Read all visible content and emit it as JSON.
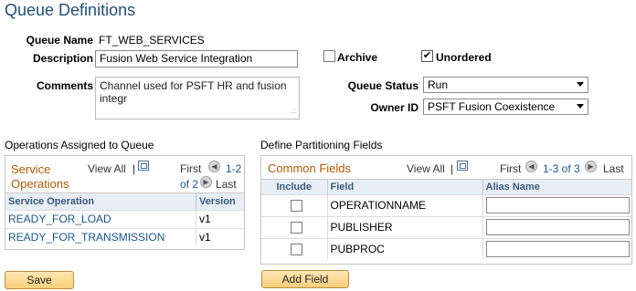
{
  "page": {
    "title": "Queue Definitions"
  },
  "form": {
    "queue_name_label": "Queue Name",
    "queue_name_value": "FT_WEB_SERVICES",
    "description_label": "Description",
    "description_value": "Fusion Web Service Integration",
    "archive_label": "Archive",
    "archive_checked": false,
    "unordered_label": "Unordered",
    "unordered_checked": true,
    "comments_label": "Comments",
    "comments_value": "Channel used for PSFT HR and fusion integr",
    "queue_status_label": "Queue Status",
    "queue_status_value": "Run",
    "owner_id_label": "Owner ID",
    "owner_id_value": "PSFT Fusion Coexistence"
  },
  "operations": {
    "section_title": "Operations Assigned to Queue",
    "caption_line1": "Service",
    "caption_line2": "Operations",
    "view_all": "View All",
    "first": "First",
    "range_line1": "1-2",
    "range_line2": "of 2",
    "last": "Last",
    "columns": [
      "Service Operation",
      "Version"
    ],
    "rows": [
      {
        "operation": "READY_FOR_LOAD",
        "version": "v1"
      },
      {
        "operation": "READY_FOR_TRANSMISSION",
        "version": "v1"
      }
    ]
  },
  "partitioning": {
    "section_title": "Define Partitioning Fields",
    "caption": "Common Fields",
    "view_all": "View All",
    "first": "First",
    "range": "1-3 of 3",
    "last": "Last",
    "columns": [
      "Include",
      "Field",
      "Alias Name"
    ],
    "rows": [
      {
        "field": "OPERATIONNAME",
        "alias": ""
      },
      {
        "field": "PUBLISHER",
        "alias": ""
      },
      {
        "field": "PUBPROC",
        "alias": ""
      }
    ]
  },
  "buttons": {
    "save": "Save",
    "add_field": "Add Field"
  },
  "colors": {
    "accent": "#b35900",
    "link": "#1a5690",
    "title": "#1f4e79"
  }
}
